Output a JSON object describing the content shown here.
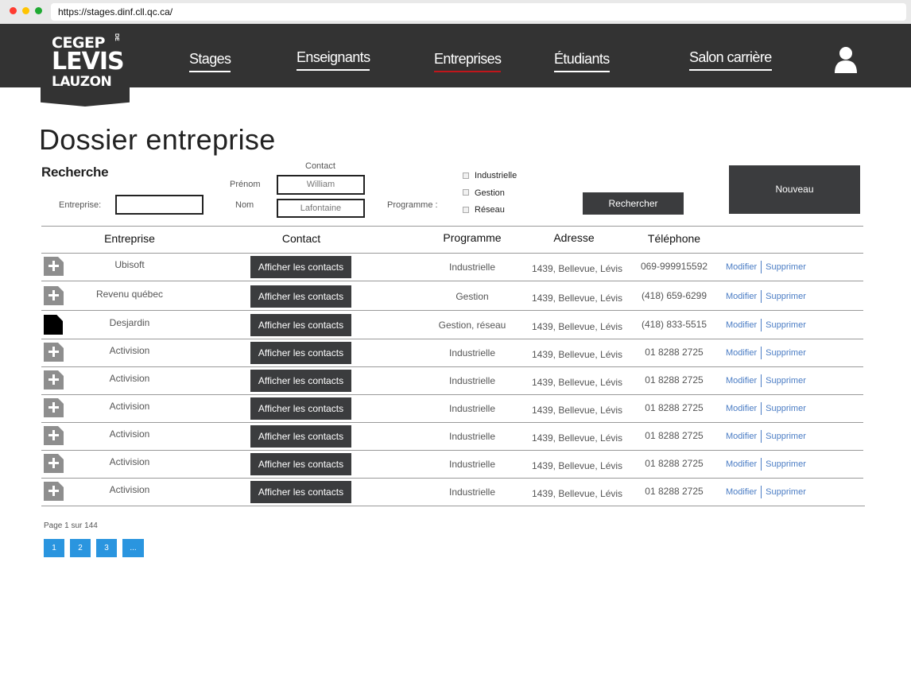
{
  "browser": {
    "url": "https://stages.dinf.cll.qc.ca/"
  },
  "logo": {
    "line1": "CEGEP",
    "de": "DE",
    "line2": "LEVIS",
    "line3": "LAUZON"
  },
  "nav": {
    "items": [
      {
        "label": "Stages"
      },
      {
        "label": "Enseignants"
      },
      {
        "label": "Entreprises"
      },
      {
        "label": "Étudiants"
      },
      {
        "label": "Salon carrière"
      }
    ],
    "active": "Entreprises"
  },
  "page_title": "Dossier entreprise",
  "search": {
    "title": "Recherche",
    "entreprise_label": "Entreprise:",
    "entreprise_value": "",
    "contact_label": "Contact",
    "prenom_label": "Prénom",
    "prenom_value": "William",
    "nom_label": "Nom",
    "nom_value": "Lafontaine",
    "programme_label": "Programme :",
    "programmes": [
      "Industrielle",
      "Gestion",
      "Réseau"
    ],
    "search_button": "Rechercher",
    "new_button": "Nouveau"
  },
  "table": {
    "headers": [
      "Entreprise",
      "Contact",
      "Programme",
      "Adresse",
      "Téléphone"
    ],
    "contacts_button": "Afficher les contacts",
    "modify_label": "Modifier",
    "delete_label": "Supprimer",
    "rows": [
      {
        "icon": "plus-icon",
        "entreprise": "Ubisoft",
        "programme": "Industrielle",
        "adresse": "1439, Bellevue, Lévis",
        "telephone": "069-999915592"
      },
      {
        "icon": "plus-icon",
        "entreprise": "Revenu québec",
        "programme": "Gestion",
        "adresse": "1439, Bellevue, Lévis",
        "telephone": "(418) 659-6299"
      },
      {
        "icon": "document-icon",
        "entreprise": "Desjardin",
        "programme": "Gestion, réseau",
        "adresse": "1439, Bellevue, Lévis",
        "telephone": "(418) 833-5515"
      },
      {
        "icon": "plus-icon",
        "entreprise": "Activision",
        "programme": "Industrielle",
        "adresse": "1439, Bellevue, Lévis",
        "telephone": "01 8288 2725"
      },
      {
        "icon": "plus-icon",
        "entreprise": "Activision",
        "programme": "Industrielle",
        "adresse": "1439, Bellevue, Lévis",
        "telephone": "01 8288 2725"
      },
      {
        "icon": "plus-icon",
        "entreprise": "Activision",
        "programme": "Industrielle",
        "adresse": "1439, Bellevue, Lévis",
        "telephone": "01 8288 2725"
      },
      {
        "icon": "plus-icon",
        "entreprise": "Activision",
        "programme": "Industrielle",
        "adresse": "1439, Bellevue, Lévis",
        "telephone": "01 8288 2725"
      },
      {
        "icon": "plus-icon",
        "entreprise": "Activision",
        "programme": "Industrielle",
        "adresse": "1439, Bellevue, Lévis",
        "telephone": "01 8288 2725"
      },
      {
        "icon": "plus-icon",
        "entreprise": "Activision",
        "programme": "Industrielle",
        "adresse": "1439, Bellevue, Lévis",
        "telephone": "01 8288 2725"
      }
    ]
  },
  "pagination": {
    "info": "Page 1 sur 144",
    "pages": [
      "1",
      "2",
      "3",
      "..."
    ]
  },
  "colors": {
    "navbar": "#333333",
    "active_underline": "#c0161b",
    "link": "#4a7cc4",
    "pagination": "#2a95df"
  }
}
